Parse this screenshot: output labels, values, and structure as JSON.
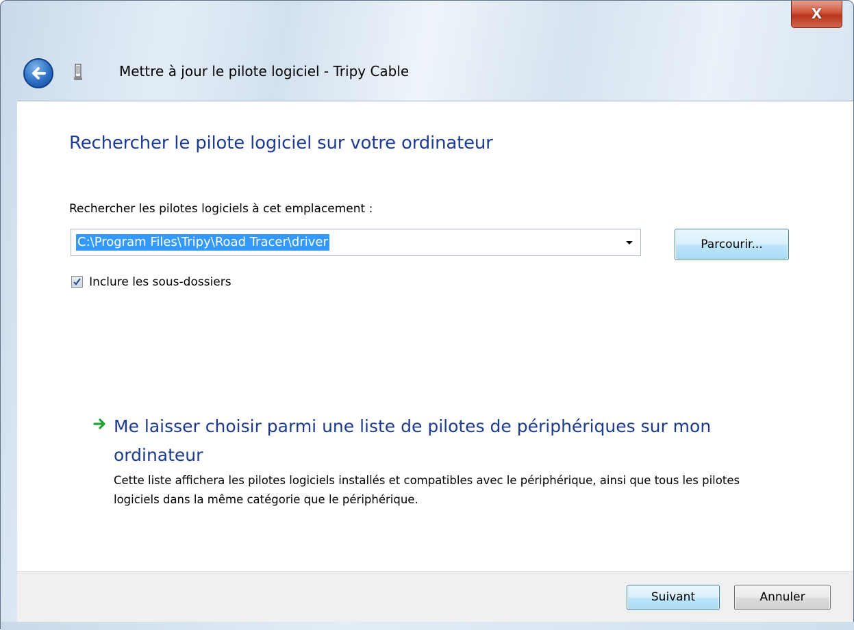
{
  "window": {
    "title": "Mettre à jour le pilote logiciel - Tripy Cable",
    "close_label": "X",
    "back_icon": "back-arrow-icon",
    "device_icon": "usb-device-icon"
  },
  "content": {
    "heading": "Rechercher le pilote logiciel sur votre ordinateur",
    "location_label": "Rechercher les pilotes logiciels à cet emplacement :",
    "path_value": "C:\\Program Files\\Tripy\\Road Tracer\\driver",
    "browse_label": "Parcourir...",
    "include_subfolders_label": "Inclure les sous-dossiers",
    "include_subfolders_checked": true,
    "choose_link": {
      "title": "Me laisser choisir parmi une liste de pilotes de périphériques sur mon ordinateur",
      "description": "Cette liste affichera les pilotes logiciels installés et compatibles avec le périphérique, ainsi que tous les pilotes logiciels dans la même catégorie que le périphérique.",
      "icon": "green-arrow-icon"
    }
  },
  "footer": {
    "next_label": "Suivant",
    "cancel_label": "Annuler"
  },
  "colors": {
    "heading": "#1e3c96",
    "link": "#1c3a8e",
    "selection": "#3399ff",
    "close": "#c7432a"
  }
}
